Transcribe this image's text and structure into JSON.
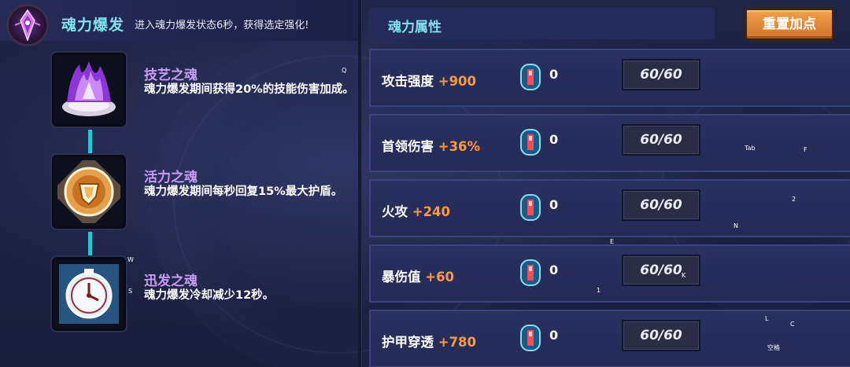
{
  "burst": {
    "title": "魂力爆发",
    "description": "进入魂力爆发状态6秒，获得选定强化!"
  },
  "talents": [
    {
      "name": "技艺之魂",
      "description": "魂力爆发期间获得20%的技能伤害加成。",
      "icon": "soul-crystal-icon"
    },
    {
      "name": "活力之魂",
      "description": "魂力爆发期间每秒回复15%最大护盾。",
      "icon": "shield-emblem-icon"
    },
    {
      "name": "迅发之魂",
      "description": "魂力爆发冷却减少12秒。",
      "icon": "clock-icon"
    }
  ],
  "attributes": {
    "title": "魂力属性",
    "reset_label": "重置加点",
    "rows": [
      {
        "name": "攻击强度",
        "bonus": "+900",
        "gems": "0",
        "points": "60/60"
      },
      {
        "name": "首领伤害",
        "bonus": "+36%",
        "gems": "0",
        "points": "60/60"
      },
      {
        "name": "火攻",
        "bonus": "+240",
        "gems": "0",
        "points": "60/60"
      },
      {
        "name": "暴伤值",
        "bonus": "+60",
        "gems": "0",
        "points": "60/60"
      },
      {
        "name": "护甲穿透",
        "bonus": "+780",
        "gems": "0",
        "points": "60/60"
      }
    ]
  },
  "key_hints": {
    "q": "Q",
    "w": "W",
    "s": "S",
    "e": "E",
    "tab": "Tab",
    "f": "F",
    "two": "2",
    "n": "N",
    "k": "K",
    "one": "1",
    "l": "L",
    "c": "C",
    "space": "空格"
  },
  "colors": {
    "accent_cyan": "#7fe2f0",
    "talent_name": "#c79cf2",
    "bonus_orange": "#ff9a3c",
    "reset_button": "#e58a3a",
    "connector": "#27c7d6"
  }
}
